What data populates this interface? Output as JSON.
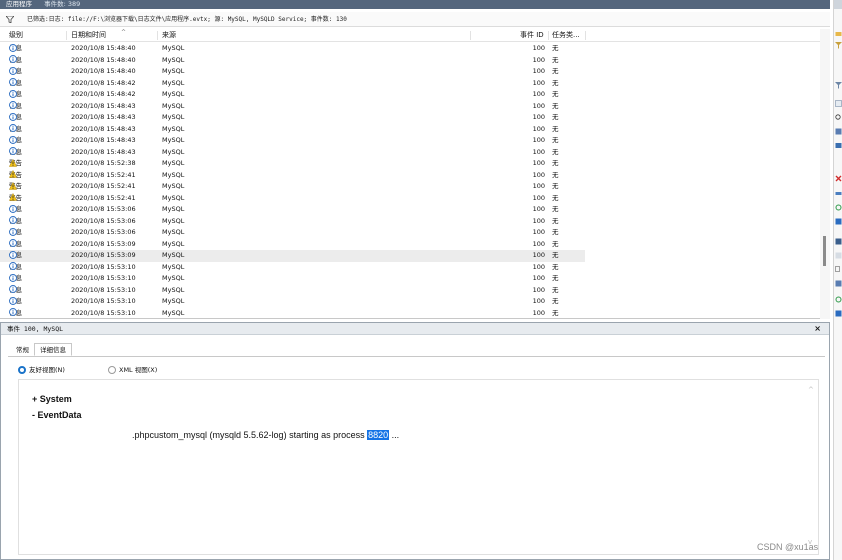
{
  "title_bar": {
    "title": "应用程序",
    "count_text": "事件数: 389"
  },
  "filter_bar": {
    "text": "已筛选:日志: file://F:\\浏览器下载\\日志文件\\应用程序.evtx; 源: MySQL, MySQLD Service; 事件数: 130"
  },
  "grid": {
    "columns": {
      "level": "级别",
      "datetime": "日期和时间",
      "source": "来源",
      "event_id": "事件 ID",
      "task": "任务类..."
    },
    "rows": [
      {
        "level": "信息",
        "icon": "info-icon",
        "datetime": "2020/10/8 15:48:40",
        "source": "MySQL",
        "event_id": "100",
        "task": "无"
      },
      {
        "level": "信息",
        "icon": "info-icon",
        "datetime": "2020/10/8 15:48:40",
        "source": "MySQL",
        "event_id": "100",
        "task": "无"
      },
      {
        "level": "信息",
        "icon": "info-icon",
        "datetime": "2020/10/8 15:48:40",
        "source": "MySQL",
        "event_id": "100",
        "task": "无"
      },
      {
        "level": "信息",
        "icon": "info-icon",
        "datetime": "2020/10/8 15:48:42",
        "source": "MySQL",
        "event_id": "100",
        "task": "无"
      },
      {
        "level": "信息",
        "icon": "info-icon",
        "datetime": "2020/10/8 15:48:42",
        "source": "MySQL",
        "event_id": "100",
        "task": "无"
      },
      {
        "level": "信息",
        "icon": "info-icon",
        "datetime": "2020/10/8 15:48:43",
        "source": "MySQL",
        "event_id": "100",
        "task": "无"
      },
      {
        "level": "信息",
        "icon": "info-icon",
        "datetime": "2020/10/8 15:48:43",
        "source": "MySQL",
        "event_id": "100",
        "task": "无"
      },
      {
        "level": "信息",
        "icon": "info-icon",
        "datetime": "2020/10/8 15:48:43",
        "source": "MySQL",
        "event_id": "100",
        "task": "无"
      },
      {
        "level": "信息",
        "icon": "info-icon",
        "datetime": "2020/10/8 15:48:43",
        "source": "MySQL",
        "event_id": "100",
        "task": "无"
      },
      {
        "level": "信息",
        "icon": "info-icon",
        "datetime": "2020/10/8 15:48:43",
        "source": "MySQL",
        "event_id": "100",
        "task": "无"
      },
      {
        "level": "警告",
        "icon": "warning-icon",
        "datetime": "2020/10/8 15:52:38",
        "source": "MySQL",
        "event_id": "100",
        "task": "无"
      },
      {
        "level": "警告",
        "icon": "warning-icon",
        "datetime": "2020/10/8 15:52:41",
        "source": "MySQL",
        "event_id": "100",
        "task": "无"
      },
      {
        "level": "警告",
        "icon": "warning-icon",
        "datetime": "2020/10/8 15:52:41",
        "source": "MySQL",
        "event_id": "100",
        "task": "无"
      },
      {
        "level": "警告",
        "icon": "warning-icon",
        "datetime": "2020/10/8 15:52:41",
        "source": "MySQL",
        "event_id": "100",
        "task": "无"
      },
      {
        "level": "信息",
        "icon": "info-icon",
        "datetime": "2020/10/8 15:53:06",
        "source": "MySQL",
        "event_id": "100",
        "task": "无"
      },
      {
        "level": "信息",
        "icon": "info-icon",
        "datetime": "2020/10/8 15:53:06",
        "source": "MySQL",
        "event_id": "100",
        "task": "无"
      },
      {
        "level": "信息",
        "icon": "info-icon",
        "datetime": "2020/10/8 15:53:06",
        "source": "MySQL",
        "event_id": "100",
        "task": "无"
      },
      {
        "level": "信息",
        "icon": "info-icon",
        "datetime": "2020/10/8 15:53:09",
        "source": "MySQL",
        "event_id": "100",
        "task": "无"
      },
      {
        "level": "信息",
        "icon": "info-icon",
        "datetime": "2020/10/8 15:53:09",
        "source": "MySQL",
        "event_id": "100",
        "task": "无",
        "selected": true
      },
      {
        "level": "信息",
        "icon": "info-icon",
        "datetime": "2020/10/8 15:53:10",
        "source": "MySQL",
        "event_id": "100",
        "task": "无"
      },
      {
        "level": "信息",
        "icon": "info-icon",
        "datetime": "2020/10/8 15:53:10",
        "source": "MySQL",
        "event_id": "100",
        "task": "无"
      },
      {
        "level": "信息",
        "icon": "info-icon",
        "datetime": "2020/10/8 15:53:10",
        "source": "MySQL",
        "event_id": "100",
        "task": "无"
      },
      {
        "level": "信息",
        "icon": "info-icon",
        "datetime": "2020/10/8 15:53:10",
        "source": "MySQL",
        "event_id": "100",
        "task": "无"
      },
      {
        "level": "信息",
        "icon": "info-icon",
        "datetime": "2020/10/8 15:53:10",
        "source": "MySQL",
        "event_id": "100",
        "task": "无"
      }
    ]
  },
  "detail": {
    "header": "事件 100, MySQL",
    "close_label": "×",
    "tabs": [
      {
        "label": "常规"
      },
      {
        "label": "详细信息",
        "active": true
      }
    ],
    "view_options": [
      {
        "label": "友好视图(N)",
        "selected": true
      },
      {
        "label": "XML 视图(X)",
        "selected": false
      }
    ],
    "tree": {
      "system_label": "+ System",
      "eventdata_label": "- EventData"
    },
    "message_prefix": ".phpcustom_mysql (mysqld 5.5.62-log) starting as process ",
    "message_highlight": "8820",
    "message_suffix": " ..."
  },
  "watermark": "CSDN @xu1as",
  "colors": {
    "title_bar": "#54667d",
    "selection_highlight": "#1473e6",
    "info_icon": "#2d6fc4",
    "warning_icon": "#f2c21b",
    "radio_accent": "#1a73c9"
  }
}
